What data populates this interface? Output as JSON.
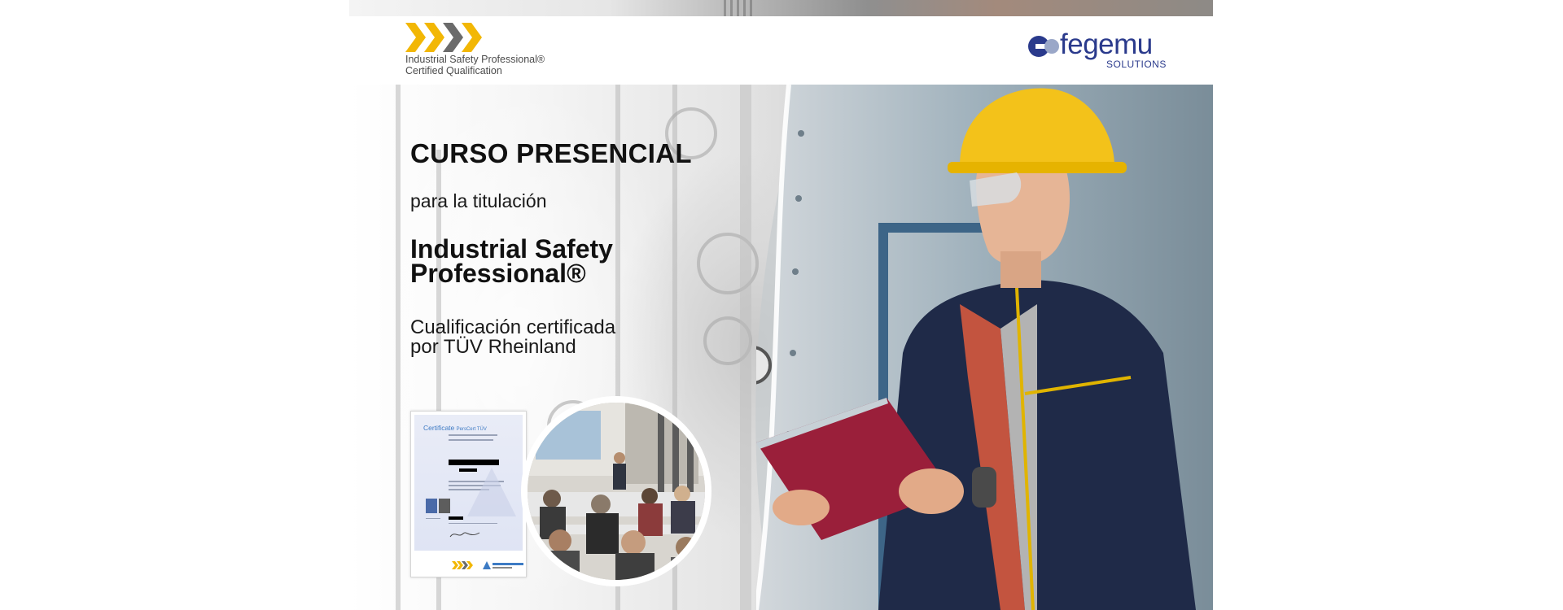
{
  "header": {
    "isp_logo": {
      "line1": "Industrial Safety Professional®",
      "line2": "Certified Qualification",
      "chevron_colors": [
        "#f2b705",
        "#f2b705",
        "#6b6b6b",
        "#f2b705"
      ]
    },
    "fegemu_logo": {
      "word": "fegemu",
      "sub": "SOLUTIONS",
      "brand_color": "#2a3a8c"
    }
  },
  "content": {
    "title": "CURSO PRESENCIAL",
    "lead": "para la titulación",
    "headline_line1": "Industrial Safety",
    "headline_line2": "Professional®",
    "sub_line1": "Cualificación certificada",
    "sub_line2": "por TÜV Rheinland"
  },
  "certificate": {
    "title": "Certificate",
    "title_suffix": "PersCert TÜV",
    "accent_color": "#3d7bc4"
  },
  "images": {
    "seminar_photo": "seminar-photo",
    "worker_photo": "worker-with-hardhat-photo"
  }
}
